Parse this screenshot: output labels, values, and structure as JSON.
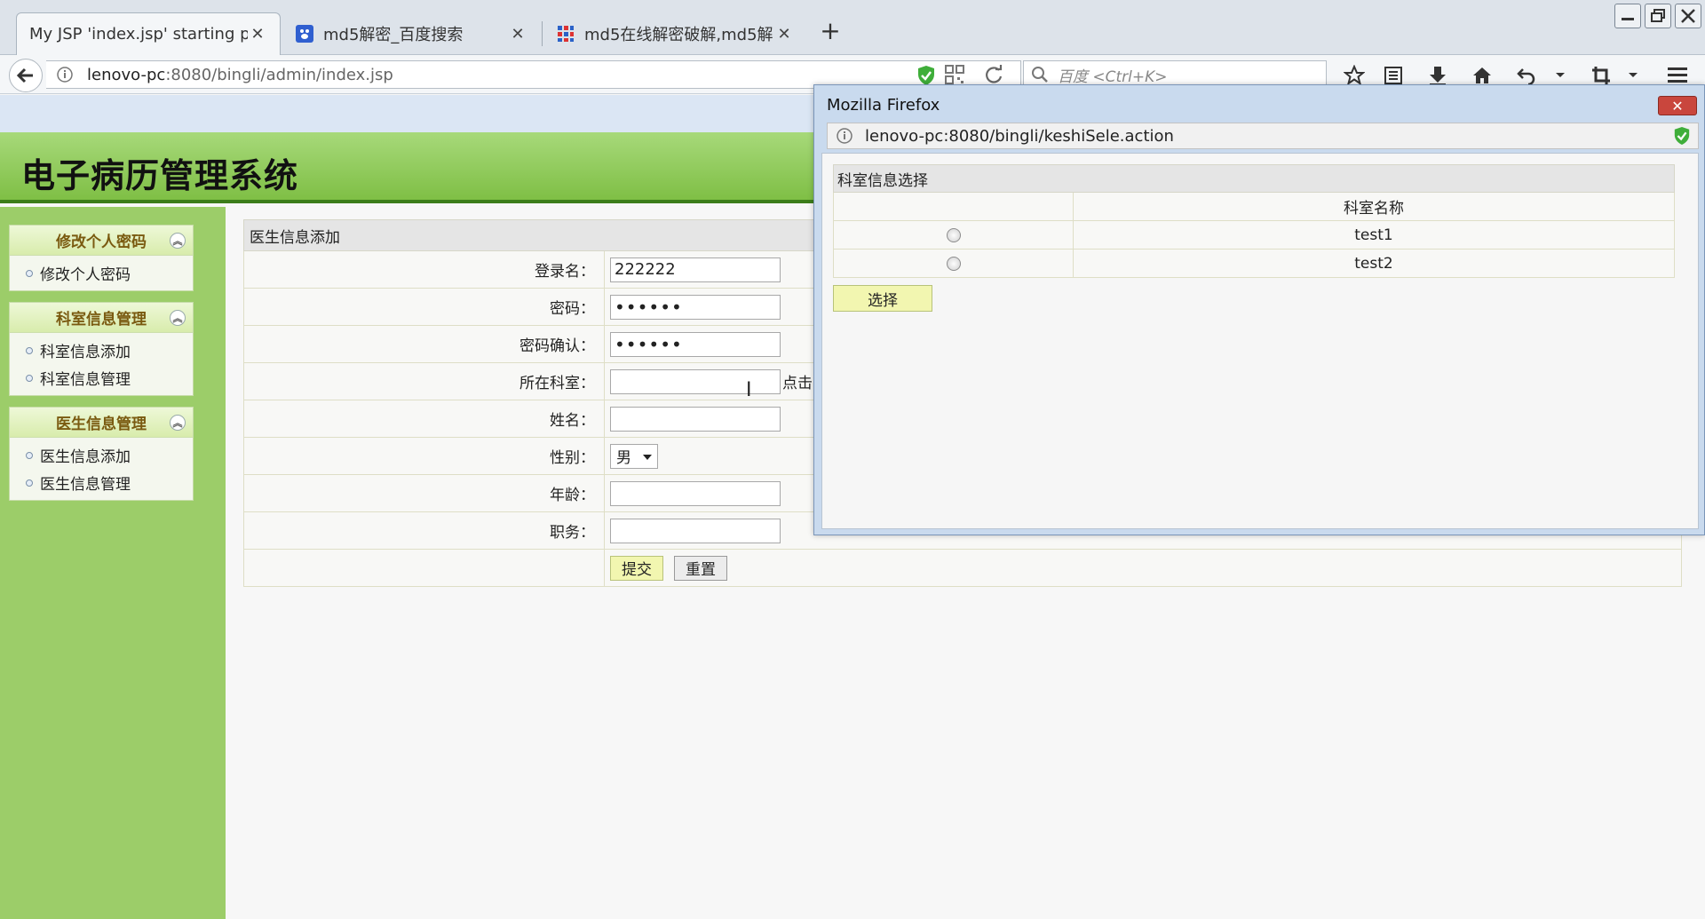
{
  "browser": {
    "tabs": [
      {
        "label": "My JSP 'index.jsp' starting p...",
        "active": true
      },
      {
        "label": "md5解密_百度搜索",
        "active": false
      },
      {
        "label": "md5在线解密破解,md5解...",
        "active": false
      }
    ],
    "url_host": "lenovo-pc",
    "url_rest": ":8080/bingli/admin/index.jsp",
    "search_placeholder": "百度 <Ctrl+K>"
  },
  "page": {
    "system_title": "电子病历管理系统",
    "sidebar": [
      {
        "title": "修改个人密码",
        "items": [
          "修改个人密码"
        ]
      },
      {
        "title": "科室信息管理",
        "items": [
          "科室信息添加",
          "科室信息管理"
        ]
      },
      {
        "title": "医生信息管理",
        "items": [
          "医生信息添加",
          "医生信息管理"
        ]
      }
    ],
    "form": {
      "heading": "医生信息添加",
      "fields": {
        "login_label": "登录名：",
        "login_value": "222222",
        "password_label": "密码：",
        "password_value": "••••••",
        "confirm_label": "密码确认：",
        "confirm_value": "••••••",
        "dept_label": "所在科室：",
        "dept_hint": "点击",
        "name_label": "姓名：",
        "gender_label": "性别：",
        "gender_value": "男",
        "age_label": "年龄：",
        "duty_label": "职务："
      },
      "submit_label": "提交",
      "reset_label": "重置"
    }
  },
  "popup": {
    "window_title": "Mozilla Firefox",
    "url": "lenovo-pc:8080/bingli/keshiSele.action",
    "heading": "科室信息选择",
    "column_name": "科室名称",
    "rows": [
      "test1",
      "test2"
    ],
    "select_label": "选择"
  }
}
